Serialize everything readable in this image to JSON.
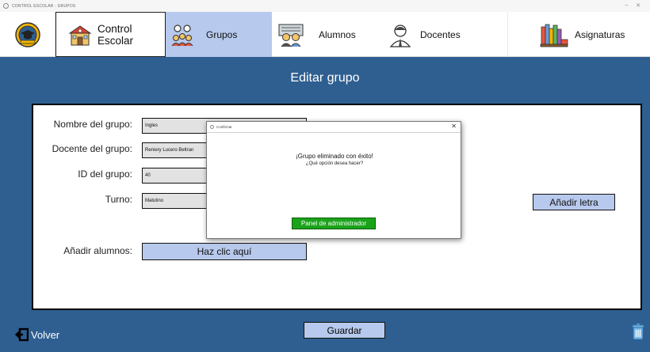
{
  "window": {
    "title": "CONTROL ESCOLAR - GRUPOS",
    "controls": [
      "–",
      "✕"
    ]
  },
  "nav": {
    "tabs": [
      {
        "label": "Control Escolar",
        "icon": "school-building-icon"
      },
      {
        "label": "Grupos",
        "icon": "group-people-icon"
      },
      {
        "label": "Alumnos",
        "icon": "students-icon"
      },
      {
        "label": "Docentes",
        "icon": "teacher-icon"
      },
      {
        "label": "Asignaturas",
        "icon": "books-icon"
      }
    ],
    "active": "Grupos"
  },
  "page": {
    "title": "Editar grupo"
  },
  "form": {
    "nombre_label": "Nombre del grupo:",
    "nombre_value": "Ingles",
    "docente_label": "Docente del grupo:",
    "docente_value": "Reniery Lucero Beltran",
    "id_label": "ID del grupo:",
    "id_value": "40",
    "turno_label": "Turno:",
    "turno_value": "Matutino",
    "alumnos_label": "Añadir alumnos:",
    "alumnos_button": "Haz clic aquí",
    "letra_button": "Añadir letra"
  },
  "footer": {
    "back_label": "Volver",
    "save_label": "Guardar"
  },
  "dialog": {
    "title": "Confirmar",
    "message": "¡Grupo eliminado con éxito!",
    "question": "¿Qué opción desea hacer?",
    "button": "Panel de administrador",
    "close": "✕"
  },
  "colors": {
    "background": "#2f5f91",
    "accent": "#b7c9ec",
    "confirm": "#1aa31a"
  }
}
